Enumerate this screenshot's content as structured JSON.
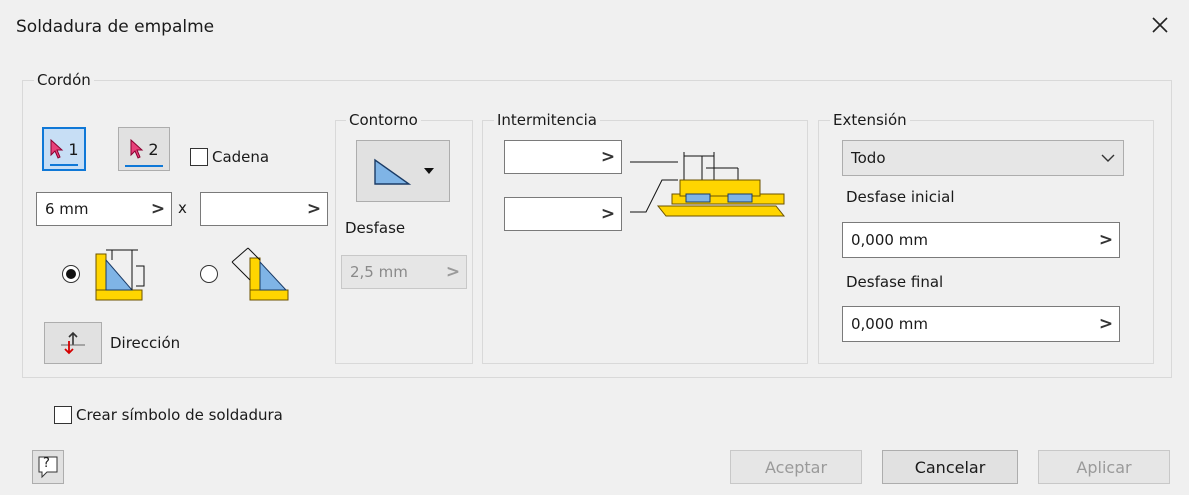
{
  "dialog": {
    "title": "Soldadura de empalme",
    "close_glyph": "✕"
  },
  "bead": {
    "group_label": "Cordón",
    "select1_label": "1",
    "select2_label": "2",
    "chain_label": "Cadena",
    "size_value": "6 mm",
    "times_label": "x",
    "size2_value": "",
    "direction_label": "Dirección"
  },
  "contour": {
    "group_label": "Contorno",
    "offset_label": "Desfase",
    "offset_value": "2,5 mm"
  },
  "intermittence": {
    "group_label": "Intermitencia",
    "value1": "",
    "value2": ""
  },
  "extension": {
    "group_label": "Extensión",
    "type_value": "Todo",
    "start_offset_label": "Desfase inicial",
    "start_offset_value": "0,000 mm",
    "end_offset_label": "Desfase final",
    "end_offset_value": "0,000 mm"
  },
  "create_symbol_label": "Crear símbolo de soldadura",
  "buttons": {
    "ok": "Aceptar",
    "cancel": "Cancelar",
    "apply": "Aplicar",
    "help_glyph": "?"
  },
  "field_arrow": ">",
  "colors": {
    "accent": "#0f78d7",
    "weld_yellow": "#ffd500",
    "weld_outline": "#8a6a00",
    "arrow_red": "#d40000"
  }
}
